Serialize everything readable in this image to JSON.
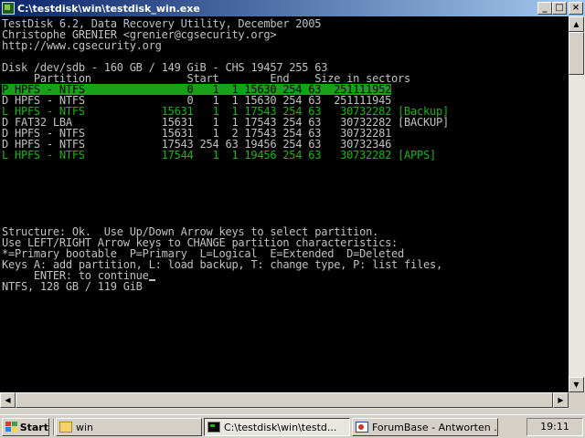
{
  "window": {
    "title": "C:\\testdisk\\win\\testdisk_win.exe",
    "controls": {
      "minimize": "_",
      "maximize": "□",
      "close": "×"
    }
  },
  "console": {
    "lines": [
      {
        "text": "TestDisk 6.2, Data Recovery Utility, December 2005",
        "style": "normal"
      },
      {
        "text": "Christophe GRENIER <grenier@cgsecurity.org>",
        "style": "normal"
      },
      {
        "text": "http://www.cgsecurity.org",
        "style": "normal"
      },
      {
        "text": "",
        "style": "normal"
      },
      {
        "text": "Disk /dev/sdb - 160 GB / 149 GiB - CHS 19457 255 63",
        "style": "normal"
      },
      {
        "text": "     Partition               Start        End    Size in sectors",
        "style": "normal"
      },
      {
        "text": "P HPFS - NTFS                0   1  1 15630 254 63  251111952",
        "style": "selected"
      },
      {
        "text": "D HPFS - NTFS                0   1  1 15630 254 63  251111945",
        "style": "normal"
      },
      {
        "text": "L HPFS - NTFS            15631   1  1 17543 254 63   30732282 [Backup]",
        "style": "green"
      },
      {
        "text": "D FAT32 LBA              15631   1  1 17543 254 63   30732282 [BACKUP]",
        "style": "normal"
      },
      {
        "text": "D HPFS - NTFS            15631   1  2 17543 254 63   30732281",
        "style": "normal"
      },
      {
        "text": "D HPFS - NTFS            17543 254 63 19456 254 63   30732346",
        "style": "normal"
      },
      {
        "text": "L HPFS - NTFS            17544   1  1 19456 254 63   30732282 [APPS]",
        "style": "green"
      },
      {
        "text": "",
        "style": "normal"
      },
      {
        "text": "",
        "style": "normal"
      },
      {
        "text": "",
        "style": "normal"
      },
      {
        "text": "",
        "style": "normal"
      },
      {
        "text": "",
        "style": "normal"
      },
      {
        "text": "",
        "style": "normal"
      },
      {
        "text": "Structure: Ok.  Use Up/Down Arrow keys to select partition.",
        "style": "normal"
      },
      {
        "text": "Use LEFT/RIGHT Arrow keys to CHANGE partition characteristics:",
        "style": "normal"
      },
      {
        "text": "*=Primary bootable  P=Primary  L=Logical  E=Extended  D=Deleted",
        "style": "normal"
      },
      {
        "text": "Keys A: add partition, L: load backup, T: change type, P: list files,",
        "style": "normal"
      },
      {
        "text": "     ENTER: to continue",
        "style": "normal",
        "cursor": true
      },
      {
        "text": "NTFS, 128 GB / 119 GiB",
        "style": "normal"
      }
    ]
  },
  "taskbar": {
    "start_label": "Start",
    "tasks": [
      {
        "label": "win",
        "icon": "folder-icon",
        "active": false
      },
      {
        "label": "C:\\testdisk\\win\\testd...",
        "icon": "console-icon",
        "active": true
      },
      {
        "label": "ForumBase - Antworten ...",
        "icon": "browser-icon",
        "active": false
      }
    ],
    "clock": "19:11"
  },
  "colors": {
    "console_bg": "#000000",
    "console_text": "#c0c0c0",
    "green_text": "#18b418",
    "selected_bg": "#18a018",
    "titlebar_start": "#0a246a",
    "titlebar_end": "#a6caf0",
    "desktop": "#3a6ea5"
  }
}
